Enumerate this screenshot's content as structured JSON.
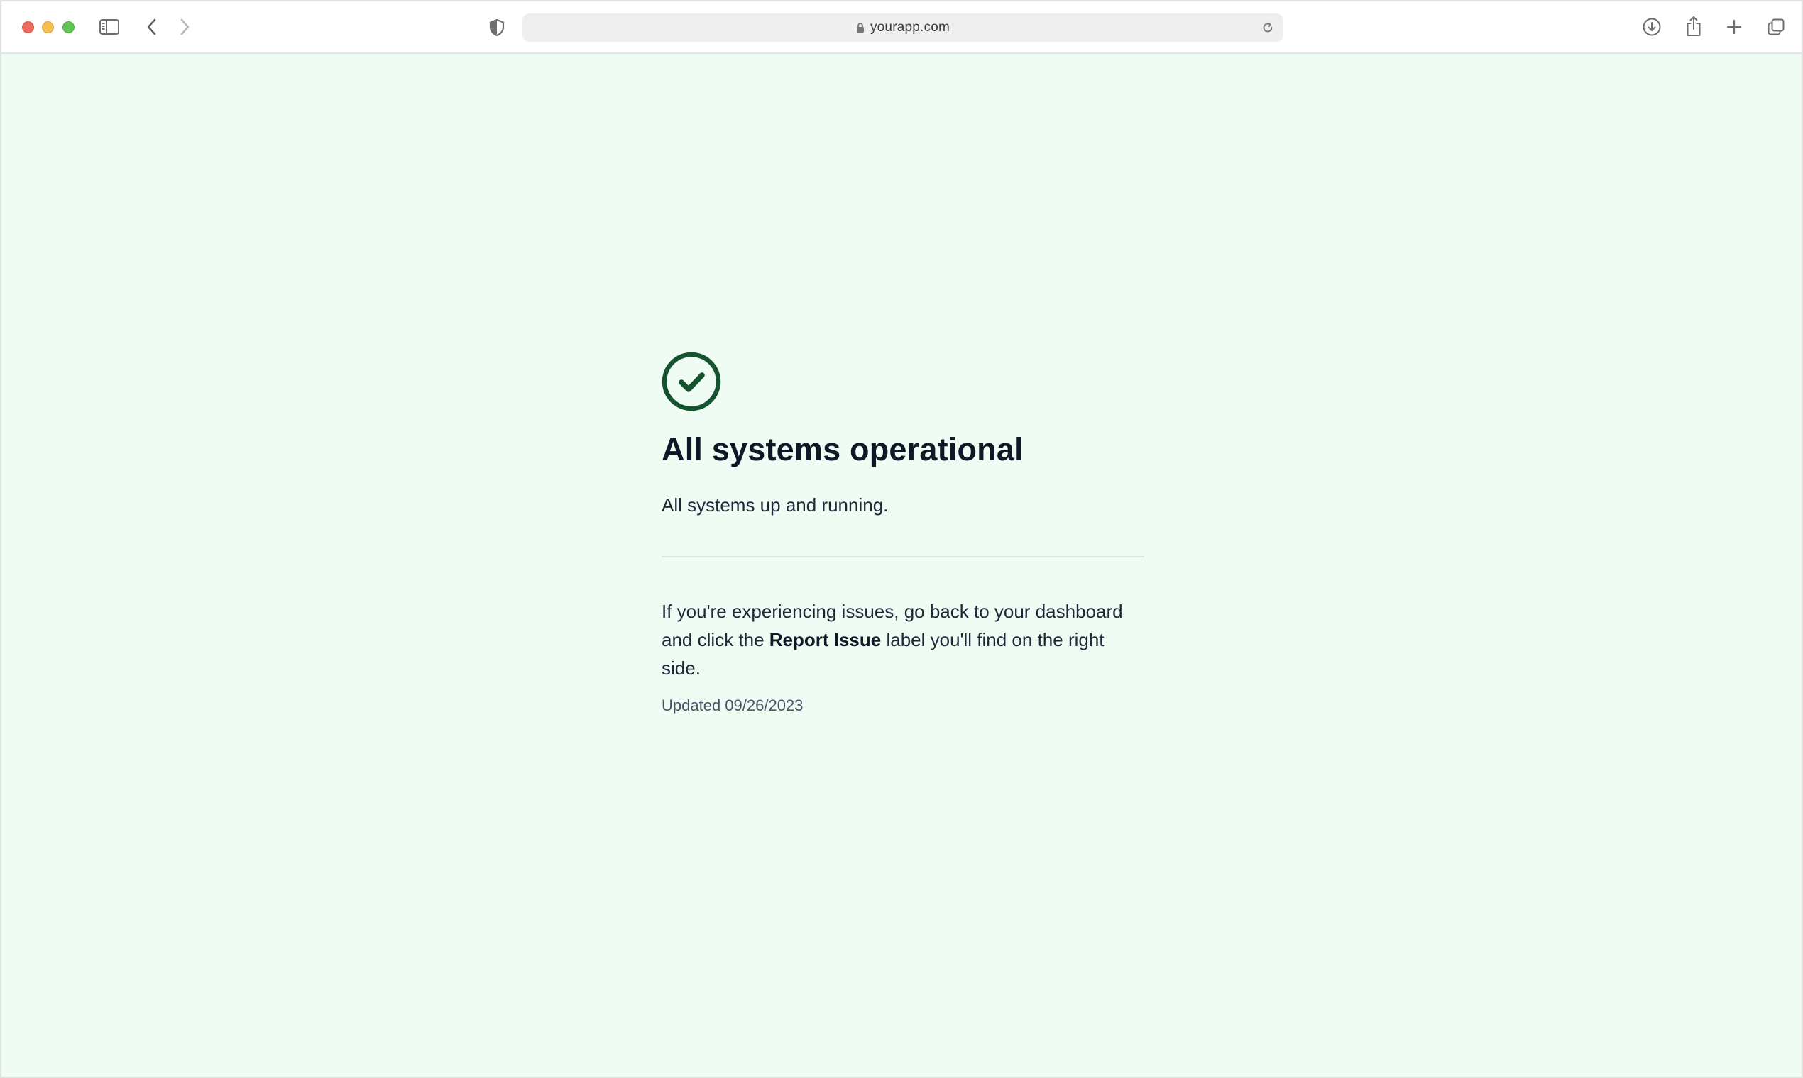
{
  "browser": {
    "url": "yourapp.com",
    "icons": {
      "close": "window-close-button",
      "minimize": "window-minimize-button",
      "maximize": "window-maximize-button",
      "sidebar": "sidebar-toggle-icon",
      "back": "chevron-left-icon",
      "forward": "chevron-right-icon",
      "privacy": "shield-icon",
      "lock": "lock-icon",
      "reload": "reload-icon",
      "download": "download-icon",
      "share": "share-icon",
      "new_tab": "plus-icon",
      "tabs": "tab-overview-icon"
    },
    "colors": {
      "close": "#ed6a5e",
      "minimize": "#f5bf4f",
      "maximize": "#61c554"
    }
  },
  "status": {
    "icon": "check-circle-icon",
    "title": "All systems operational",
    "subtitle": "All systems up and running.",
    "info_before": "If you're experiencing issues, go back to your dashboard and click the ",
    "info_emphasis": "Report Issue",
    "info_after": " label you'll find on the right side.",
    "updated": "Updated 09/26/2023"
  },
  "theme": {
    "background": "#effcf3",
    "accent": "#14532d",
    "title_color": "#101828"
  }
}
